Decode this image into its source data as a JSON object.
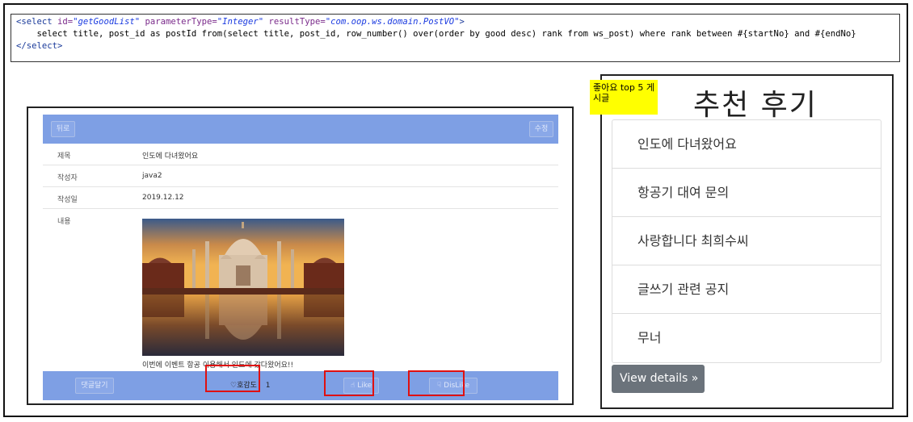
{
  "code": {
    "line1_open": "<select ",
    "line1_id_attr": "id=",
    "line1_id_val": "\"getGoodList\"",
    "line1_pt_attr": " parameterType=",
    "line1_pt_val": "\"Integer\"",
    "line1_rt_attr": " resultType=",
    "line1_rt_val": "\"com.oop.ws.domain.PostVO\"",
    "line1_close": ">",
    "line2": "    select title, post_id as postId from(select title, post_id, row_number() over(order by good desc) rank from ws_post) where rank between #{startNo} and #{endNo}",
    "line3": "</select>"
  },
  "post": {
    "back_button": "뒤로",
    "edit_button": "수정",
    "fields": [
      {
        "label": "제목",
        "value": "인도에 다녀왔어요"
      },
      {
        "label": "작성자",
        "value": "java2"
      },
      {
        "label": "작성일",
        "value": "2019.12.12"
      },
      {
        "label": "내용",
        "value": ""
      }
    ],
    "caption": "이번에 이벤트 항공 이용해서 인도에 갔다왔어요!!",
    "comment_button": "댓글달기",
    "heart_label": "♡호감도",
    "like_count": "1",
    "like_button": "Like",
    "dislike_button": "DisLike"
  },
  "recommend": {
    "note": "좋아요 top 5 게시글",
    "title": "추천 후기",
    "items": [
      "인도에 다녀왔어요",
      "항공기 대여 문의",
      "사랑합니다 최희수씨",
      "글쓰기 관련 공지",
      "무너"
    ],
    "view_details": "View details »"
  },
  "colors": {
    "header_blue": "#7e9fe4",
    "highlight_red": "#e01010",
    "note_yellow": "#ffff00",
    "button_gray": "#6b737b"
  }
}
